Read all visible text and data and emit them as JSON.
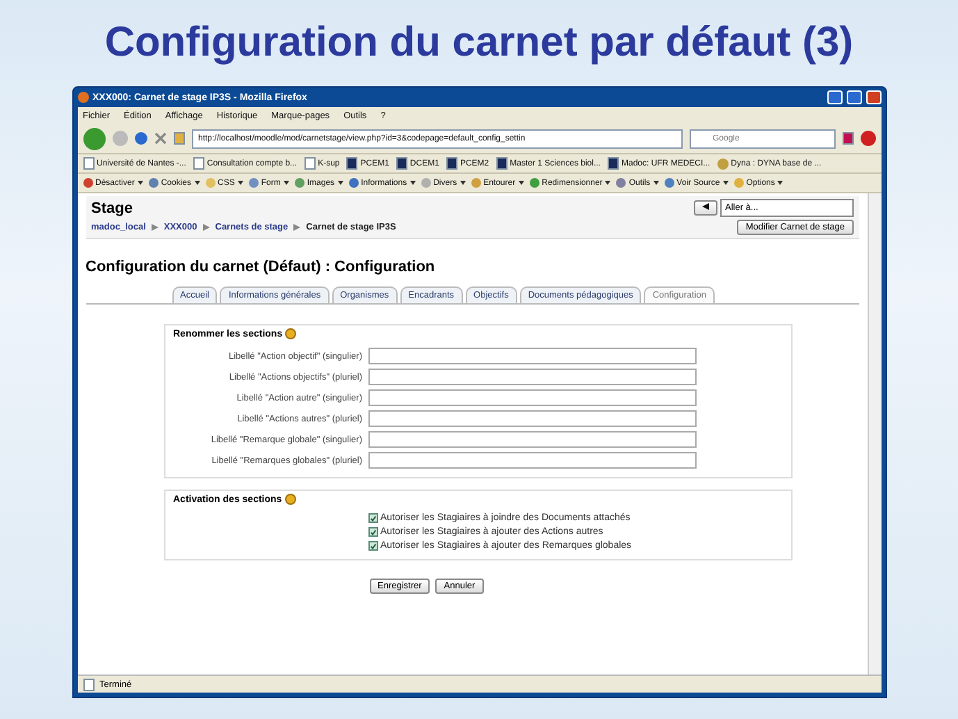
{
  "slide_title": "Configuration du carnet par défaut (3)",
  "window": {
    "title": "XXX000: Carnet de stage IP3S - Mozilla Firefox"
  },
  "menu": [
    "Fichier",
    "Édition",
    "Affichage",
    "Historique",
    "Marque-pages",
    "Outils",
    "?"
  ],
  "address": {
    "url": "http://localhost/moodle/mod/carnetstage/view.php?id=3&codepage=default_config_settin"
  },
  "search": {
    "placeholder": "Google"
  },
  "bookmarks": [
    {
      "label": "Université de Nantes -...",
      "kind": "page"
    },
    {
      "label": "Consultation compte b...",
      "kind": "page"
    },
    {
      "label": "K-sup",
      "kind": "page"
    },
    {
      "label": "PCEM1",
      "kind": "site"
    },
    {
      "label": "DCEM1",
      "kind": "site"
    },
    {
      "label": "PCEM2",
      "kind": "site"
    },
    {
      "label": "Master 1 Sciences biol...",
      "kind": "site"
    },
    {
      "label": "Madoc: UFR MEDECI...",
      "kind": "site"
    },
    {
      "label": "Dyna : DYNA base de ...",
      "kind": "people"
    }
  ],
  "devbar": [
    {
      "label": "Désactiver",
      "color": "#d04030"
    },
    {
      "label": "Cookies",
      "color": "#6080b0"
    },
    {
      "label": "CSS",
      "color": "#e0c060"
    },
    {
      "label": "Form",
      "color": "#7090c0"
    },
    {
      "label": "Images",
      "color": "#60a060"
    },
    {
      "label": "Informations",
      "color": "#4070c0"
    },
    {
      "label": "Divers",
      "color": "#b0b0b0"
    },
    {
      "label": "Entourer",
      "color": "#d0a040"
    },
    {
      "label": "Redimensionner",
      "color": "#40a040"
    },
    {
      "label": "Outils",
      "color": "#8080a0"
    },
    {
      "label": "Voir Source",
      "color": "#5080c0"
    },
    {
      "label": "Options",
      "color": "#e0b040"
    }
  ],
  "page": {
    "heading": "Stage",
    "jump": {
      "value": "Aller à..."
    },
    "breadcrumb": [
      {
        "label": "madoc_local",
        "kind": "link"
      },
      {
        "label": "XXX000",
        "kind": "link"
      },
      {
        "label": "Carnets de stage",
        "kind": "link"
      },
      {
        "label": "Carnet de stage IP3S",
        "kind": "current"
      }
    ],
    "edit_button": "Modifier Carnet de stage",
    "title": "Configuration du carnet (Défaut) : Configuration",
    "tabs": [
      {
        "label": "Accueil",
        "selected": false
      },
      {
        "label": "Informations générales",
        "selected": false
      },
      {
        "label": "Organismes",
        "selected": false
      },
      {
        "label": "Encadrants",
        "selected": false
      },
      {
        "label": "Objectifs",
        "selected": false
      },
      {
        "label": "Documents pédagogiques",
        "selected": false
      },
      {
        "label": "Configuration",
        "selected": true
      }
    ],
    "rename": {
      "title": "Renommer les sections",
      "fields": [
        {
          "label": "Libellé \"Action objectif\" (singulier)"
        },
        {
          "label": "Libellé \"Actions objectifs\" (pluriel)"
        },
        {
          "label": "Libellé \"Action autre\" (singulier)"
        },
        {
          "label": "Libellé \"Actions autres\" (pluriel)"
        },
        {
          "label": "Libellé \"Remarque globale\" (singulier)"
        },
        {
          "label": "Libellé \"Remarques globales\" (pluriel)"
        }
      ]
    },
    "activation": {
      "title": "Activation des sections",
      "options": [
        {
          "label": "Autoriser les Stagiaires à joindre des Documents attachés",
          "checked": true
        },
        {
          "label": "Autoriser les Stagiaires à ajouter des Actions autres",
          "checked": true
        },
        {
          "label": "Autoriser les Stagiaires à ajouter des Remarques globales",
          "checked": true
        }
      ]
    },
    "buttons": [
      "Enregistrer",
      "Annuler"
    ]
  },
  "status_bar": {
    "text": "Terminé"
  }
}
